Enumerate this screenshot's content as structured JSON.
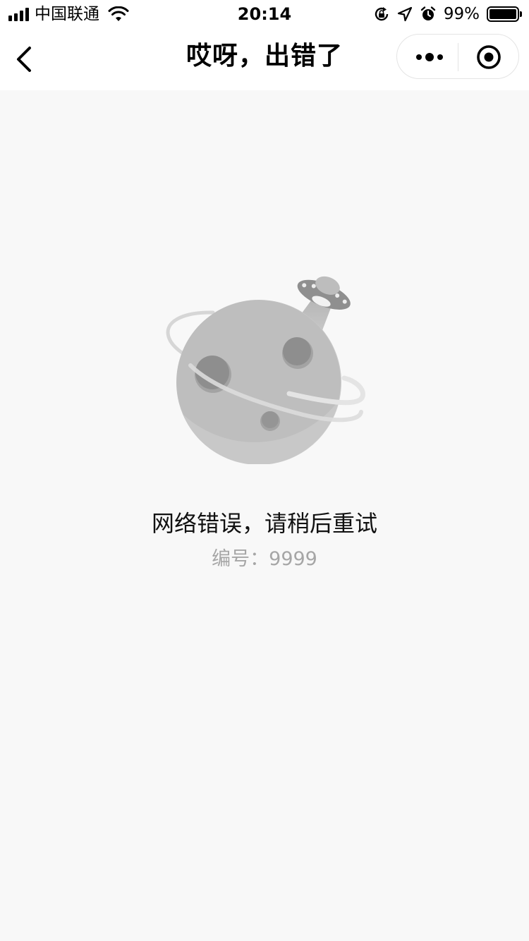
{
  "status_bar": {
    "carrier": "中国联通",
    "time": "20:14",
    "battery_percent": "99%",
    "battery_level": 0.99,
    "icons": [
      "signal-icon",
      "wifi-icon",
      "orientation-lock-icon",
      "location-arrow-icon",
      "alarm-icon",
      "battery-icon"
    ]
  },
  "nav_bar": {
    "title": "哎呀，出错了",
    "icons": [
      "back-chevron-icon",
      "more-dots-icon",
      "close-circle-icon"
    ]
  },
  "error": {
    "message": "网络错误，请稍后重试",
    "code_label": "编号：",
    "code_value": "9999",
    "illustration": "planet-ufo-illustration"
  },
  "colors": {
    "background": "#f8f8f8",
    "bar_background": "#ffffff",
    "text_primary": "#111111",
    "text_secondary": "#a6a6a6"
  }
}
